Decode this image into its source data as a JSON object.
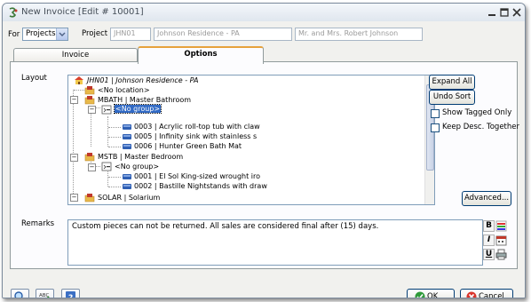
{
  "window": {
    "title": "New Invoice [Edit # 10001]"
  },
  "header": {
    "for_label": "For",
    "for_value": "Projects",
    "project_label": "Project",
    "project_code": "JHN01",
    "project_name": "Johnson Residence - PA",
    "client_name": "Mr. and Mrs. Robert Johnson"
  },
  "tabs": [
    {
      "label": "Invoice",
      "active": false
    },
    {
      "label": "Options",
      "active": true
    }
  ],
  "layout": {
    "label": "Layout",
    "tree": [
      {
        "text": "JHN01 | Johnson Residence - PA"
      },
      {
        "text": "<No location>"
      },
      {
        "text": "MBATH | Master Bathroom"
      },
      {
        "text": "<No group>"
      },
      {
        "text": "0003 | Acrylic roll-top tub with claw"
      },
      {
        "text": "0005 | Infinity sink with stainless s"
      },
      {
        "text": "0006 | Hunter Green Bath Mat"
      },
      {
        "text": "MSTB | Master Bedroom"
      },
      {
        "text": "<No group>"
      },
      {
        "text": "0001 | El Sol  King-sized wrought iro"
      },
      {
        "text": "0002 | Bastille Nightstands with draw"
      },
      {
        "text": "SOLAR | Solarium"
      }
    ],
    "expand_all_label": "Expand All",
    "undo_sort_label": "Undo Sort",
    "show_tagged_only_label": "Show Tagged Only",
    "show_tagged_only_checked": false,
    "keep_desc_together_label": "Keep Desc. Together",
    "keep_desc_together_checked": false,
    "advanced_label": "Advanced..."
  },
  "remarks": {
    "label": "Remarks",
    "text": "Custom pieces can not be returned. All sales are considered final after (15) days."
  },
  "footer": {
    "ok_label": "OK",
    "cancel_label": "Cancel"
  },
  "colors": {
    "selection": "#316ac5",
    "tab_accent": "#e6a23c",
    "panel_bg": "#fcfcfe",
    "window_bg": "#f1f1ee"
  }
}
